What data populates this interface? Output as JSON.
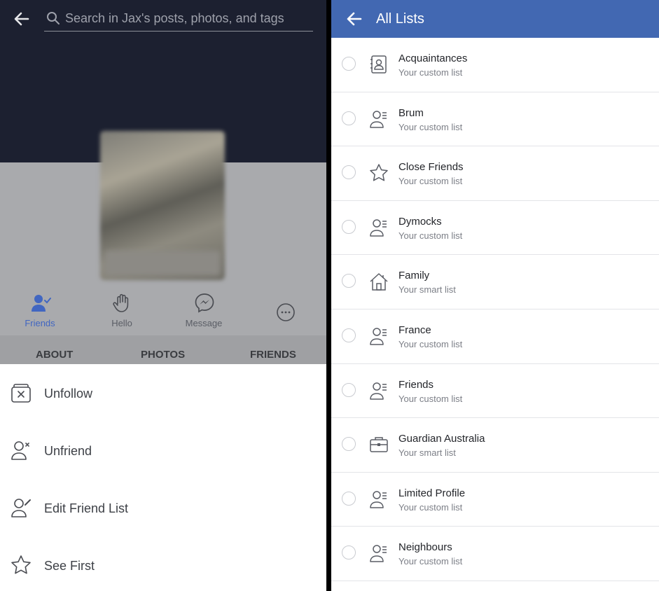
{
  "left": {
    "search": {
      "placeholder": "Search in Jax's posts, photos, and tags"
    },
    "actions": [
      {
        "label": "Friends",
        "icon": "friends-check-icon",
        "active": true
      },
      {
        "label": "Hello",
        "icon": "wave-hand-icon"
      },
      {
        "label": "Message",
        "icon": "messenger-icon"
      },
      {
        "label": "",
        "icon": "more-icon"
      }
    ],
    "tabs": [
      "ABOUT",
      "PHOTOS",
      "FRIENDS"
    ],
    "menu": [
      {
        "label": "Unfollow",
        "icon": "unfollow-icon"
      },
      {
        "label": "Unfriend",
        "icon": "unfriend-icon"
      },
      {
        "label": "Edit Friend List",
        "icon": "edit-friend-list-icon"
      },
      {
        "label": "See First",
        "icon": "star-icon"
      }
    ]
  },
  "right": {
    "title": "All Lists",
    "lists": [
      {
        "name": "Acquaintances",
        "sub": "Your custom list",
        "icon": "contact-card-icon"
      },
      {
        "name": "Brum",
        "sub": "Your custom list",
        "icon": "person-list-icon"
      },
      {
        "name": "Close Friends",
        "sub": "Your custom list",
        "icon": "star-icon"
      },
      {
        "name": "Dymocks",
        "sub": "Your custom list",
        "icon": "person-list-icon"
      },
      {
        "name": "Family",
        "sub": "Your smart list",
        "icon": "house-icon"
      },
      {
        "name": "France",
        "sub": "Your custom list",
        "icon": "person-list-icon"
      },
      {
        "name": "Friends",
        "sub": "Your custom list",
        "icon": "person-list-icon"
      },
      {
        "name": "Guardian Australia",
        "sub": "Your smart list",
        "icon": "briefcase-icon"
      },
      {
        "name": "Limited Profile",
        "sub": "Your custom list",
        "icon": "person-list-icon"
      },
      {
        "name": "Neighbours",
        "sub": "Your custom list",
        "icon": "person-list-icon"
      }
    ]
  },
  "colors": {
    "header_blue": "#4268b2",
    "active_blue": "#4166c1",
    "cover_dark": "#1c2030"
  }
}
